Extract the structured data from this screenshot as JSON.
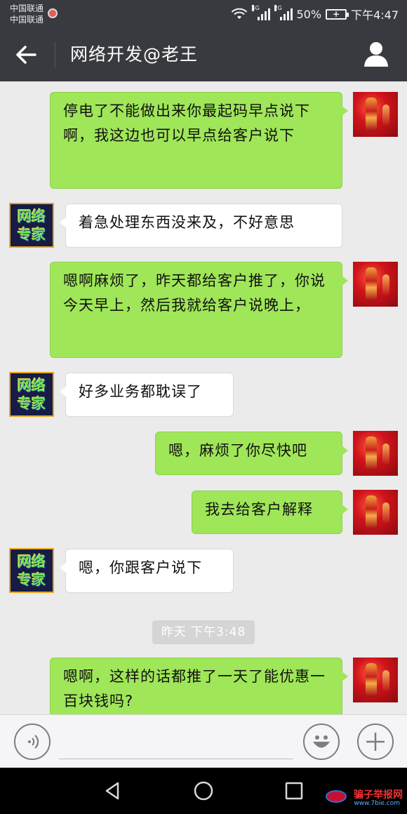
{
  "status_bar": {
    "carrier_1": "中国联通",
    "carrier_2": "中国联通",
    "net_1": "4G",
    "net_2": "2G",
    "battery_text": "50%",
    "time": "下午4:47"
  },
  "header": {
    "title": "网络开发@老王",
    "back_icon": "back-arrow-icon",
    "profile_icon": "person-icon"
  },
  "contact_avatar": {
    "line1": "网络",
    "line2": "专家"
  },
  "messages": [
    {
      "side": "out",
      "text": "停电了不能做出来你最起码早点说下啊，我这边也可以早点给客户说下"
    },
    {
      "side": "in",
      "text": "着急处理东西没来及，不好意思"
    },
    {
      "side": "out",
      "text": "嗯啊麻烦了，昨天都给客户推了，你说今天早上，然后我就给客户说晚上，"
    },
    {
      "side": "in",
      "text": "好多业务都耽误了"
    },
    {
      "side": "out",
      "text": "嗯，麻烦了你尽快吧"
    },
    {
      "side": "out",
      "text": "我去给客户解释"
    },
    {
      "side": "in",
      "text": "嗯，你跟客户说下"
    },
    {
      "side": "out",
      "text": "嗯啊，这样的话都推了一天了能优惠一百块钱吗?"
    }
  ],
  "timestamp": "昨天 下午3:48",
  "input_bar": {
    "voice_icon": "voice-icon",
    "emoji_icon": "emoji-icon",
    "plus_icon": "plus-icon"
  },
  "nav_bar": {
    "back_icon": "nav-back-icon",
    "home_icon": "nav-home-icon",
    "recents_icon": "nav-recents-icon"
  },
  "watermark": {
    "main": "骗子举报网",
    "sub": "www.7bie.com"
  },
  "colors": {
    "bar": "#393a3f",
    "out_bubble": "#9fe658",
    "in_bubble": "#ffffff",
    "background": "#ebebeb"
  }
}
